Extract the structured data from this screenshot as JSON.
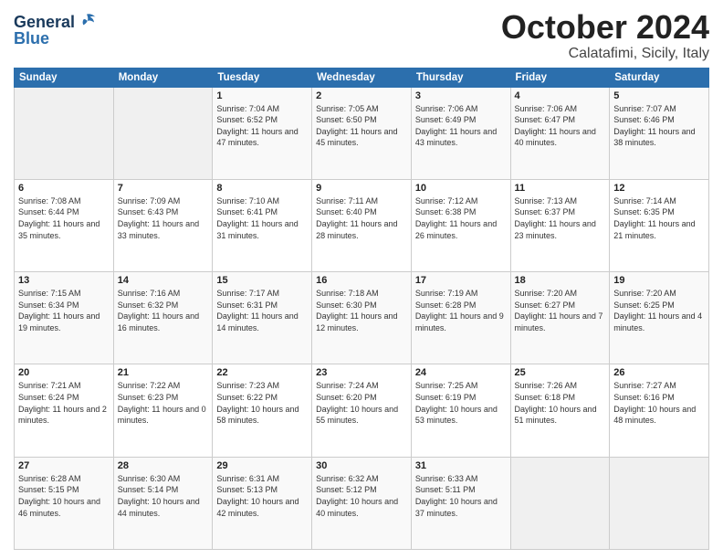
{
  "logo": {
    "line1": "General",
    "line2": "Blue"
  },
  "title": "October 2024",
  "location": "Calatafimi, Sicily, Italy",
  "days_of_week": [
    "Sunday",
    "Monday",
    "Tuesday",
    "Wednesday",
    "Thursday",
    "Friday",
    "Saturday"
  ],
  "weeks": [
    [
      {
        "day": "",
        "info": ""
      },
      {
        "day": "",
        "info": ""
      },
      {
        "day": "1",
        "info": "Sunrise: 7:04 AM\nSunset: 6:52 PM\nDaylight: 11 hours and 47 minutes."
      },
      {
        "day": "2",
        "info": "Sunrise: 7:05 AM\nSunset: 6:50 PM\nDaylight: 11 hours and 45 minutes."
      },
      {
        "day": "3",
        "info": "Sunrise: 7:06 AM\nSunset: 6:49 PM\nDaylight: 11 hours and 43 minutes."
      },
      {
        "day": "4",
        "info": "Sunrise: 7:06 AM\nSunset: 6:47 PM\nDaylight: 11 hours and 40 minutes."
      },
      {
        "day": "5",
        "info": "Sunrise: 7:07 AM\nSunset: 6:46 PM\nDaylight: 11 hours and 38 minutes."
      }
    ],
    [
      {
        "day": "6",
        "info": "Sunrise: 7:08 AM\nSunset: 6:44 PM\nDaylight: 11 hours and 35 minutes."
      },
      {
        "day": "7",
        "info": "Sunrise: 7:09 AM\nSunset: 6:43 PM\nDaylight: 11 hours and 33 minutes."
      },
      {
        "day": "8",
        "info": "Sunrise: 7:10 AM\nSunset: 6:41 PM\nDaylight: 11 hours and 31 minutes."
      },
      {
        "day": "9",
        "info": "Sunrise: 7:11 AM\nSunset: 6:40 PM\nDaylight: 11 hours and 28 minutes."
      },
      {
        "day": "10",
        "info": "Sunrise: 7:12 AM\nSunset: 6:38 PM\nDaylight: 11 hours and 26 minutes."
      },
      {
        "day": "11",
        "info": "Sunrise: 7:13 AM\nSunset: 6:37 PM\nDaylight: 11 hours and 23 minutes."
      },
      {
        "day": "12",
        "info": "Sunrise: 7:14 AM\nSunset: 6:35 PM\nDaylight: 11 hours and 21 minutes."
      }
    ],
    [
      {
        "day": "13",
        "info": "Sunrise: 7:15 AM\nSunset: 6:34 PM\nDaylight: 11 hours and 19 minutes."
      },
      {
        "day": "14",
        "info": "Sunrise: 7:16 AM\nSunset: 6:32 PM\nDaylight: 11 hours and 16 minutes."
      },
      {
        "day": "15",
        "info": "Sunrise: 7:17 AM\nSunset: 6:31 PM\nDaylight: 11 hours and 14 minutes."
      },
      {
        "day": "16",
        "info": "Sunrise: 7:18 AM\nSunset: 6:30 PM\nDaylight: 11 hours and 12 minutes."
      },
      {
        "day": "17",
        "info": "Sunrise: 7:19 AM\nSunset: 6:28 PM\nDaylight: 11 hours and 9 minutes."
      },
      {
        "day": "18",
        "info": "Sunrise: 7:20 AM\nSunset: 6:27 PM\nDaylight: 11 hours and 7 minutes."
      },
      {
        "day": "19",
        "info": "Sunrise: 7:20 AM\nSunset: 6:25 PM\nDaylight: 11 hours and 4 minutes."
      }
    ],
    [
      {
        "day": "20",
        "info": "Sunrise: 7:21 AM\nSunset: 6:24 PM\nDaylight: 11 hours and 2 minutes."
      },
      {
        "day": "21",
        "info": "Sunrise: 7:22 AM\nSunset: 6:23 PM\nDaylight: 11 hours and 0 minutes."
      },
      {
        "day": "22",
        "info": "Sunrise: 7:23 AM\nSunset: 6:22 PM\nDaylight: 10 hours and 58 minutes."
      },
      {
        "day": "23",
        "info": "Sunrise: 7:24 AM\nSunset: 6:20 PM\nDaylight: 10 hours and 55 minutes."
      },
      {
        "day": "24",
        "info": "Sunrise: 7:25 AM\nSunset: 6:19 PM\nDaylight: 10 hours and 53 minutes."
      },
      {
        "day": "25",
        "info": "Sunrise: 7:26 AM\nSunset: 6:18 PM\nDaylight: 10 hours and 51 minutes."
      },
      {
        "day": "26",
        "info": "Sunrise: 7:27 AM\nSunset: 6:16 PM\nDaylight: 10 hours and 48 minutes."
      }
    ],
    [
      {
        "day": "27",
        "info": "Sunrise: 6:28 AM\nSunset: 5:15 PM\nDaylight: 10 hours and 46 minutes."
      },
      {
        "day": "28",
        "info": "Sunrise: 6:30 AM\nSunset: 5:14 PM\nDaylight: 10 hours and 44 minutes."
      },
      {
        "day": "29",
        "info": "Sunrise: 6:31 AM\nSunset: 5:13 PM\nDaylight: 10 hours and 42 minutes."
      },
      {
        "day": "30",
        "info": "Sunrise: 6:32 AM\nSunset: 5:12 PM\nDaylight: 10 hours and 40 minutes."
      },
      {
        "day": "31",
        "info": "Sunrise: 6:33 AM\nSunset: 5:11 PM\nDaylight: 10 hours and 37 minutes."
      },
      {
        "day": "",
        "info": ""
      },
      {
        "day": "",
        "info": ""
      }
    ]
  ]
}
